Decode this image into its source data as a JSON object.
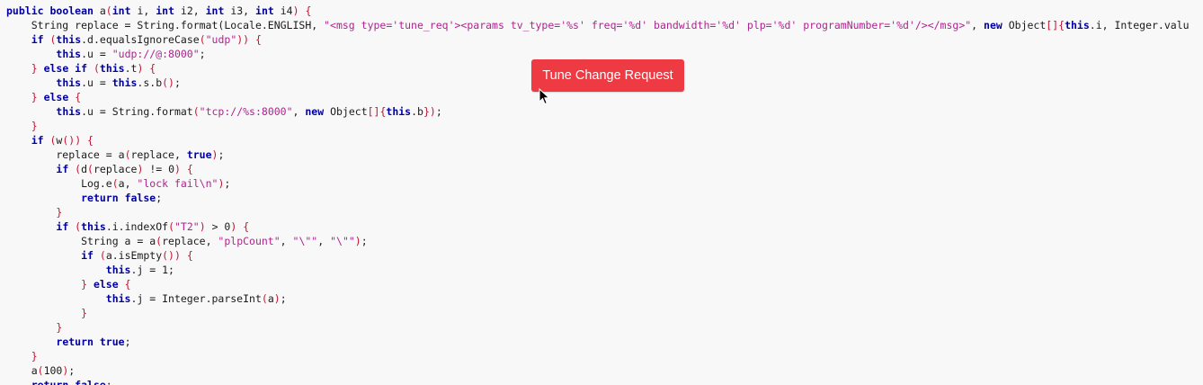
{
  "button": {
    "label": "Tune Change Request"
  },
  "cursor_icon": "arrow-pointer-icon",
  "colors": {
    "keyword": "#0000a0",
    "punctuation": "#c8102e",
    "string": "#b0238f",
    "text": "#1a1a1a",
    "button_bg": "#ee3a43",
    "background": "#f8f8f8"
  },
  "code_lines": [
    [
      [
        "kw",
        "public "
      ],
      [
        "kw",
        "boolean "
      ],
      [
        "plain",
        "a"
      ],
      [
        "punc",
        "("
      ],
      [
        "kw",
        "int "
      ],
      [
        "plain",
        "i, "
      ],
      [
        "kw",
        "int "
      ],
      [
        "plain",
        "i2, "
      ],
      [
        "kw",
        "int "
      ],
      [
        "plain",
        "i3, "
      ],
      [
        "kw",
        "int "
      ],
      [
        "plain",
        "i4"
      ],
      [
        "punc",
        ") {"
      ]
    ],
    [
      [
        "plain",
        "    String replace = String.format(Locale.ENGLISH, "
      ],
      [
        "str",
        "\"<msg type='tune_req'><params tv_type='%s' freq='%d' bandwidth='%d' plp='%d' programNumber='%d'/></msg>\""
      ],
      [
        "plain",
        ", "
      ],
      [
        "kw",
        "new "
      ],
      [
        "plain",
        "Object"
      ],
      [
        "punc",
        "[]{"
      ],
      [
        "kw",
        "this"
      ],
      [
        "plain",
        ".i, Integer.valu"
      ]
    ],
    [
      [
        "plain",
        "    "
      ],
      [
        "kw",
        "if "
      ],
      [
        "punc",
        "("
      ],
      [
        "kw",
        "this"
      ],
      [
        "plain",
        ".d.equalsIgnoreCase"
      ],
      [
        "punc",
        "("
      ],
      [
        "str",
        "\"udp\""
      ],
      [
        "punc",
        ")) {"
      ]
    ],
    [
      [
        "plain",
        "        "
      ],
      [
        "kw",
        "this"
      ],
      [
        "plain",
        ".u = "
      ],
      [
        "str",
        "\"udp://@:8000\""
      ],
      [
        "plain",
        ";"
      ]
    ],
    [
      [
        "plain",
        "    "
      ],
      [
        "punc",
        "} "
      ],
      [
        "kw",
        "else if "
      ],
      [
        "punc",
        "("
      ],
      [
        "kw",
        "this"
      ],
      [
        "plain",
        ".t"
      ],
      [
        "punc",
        ") {"
      ]
    ],
    [
      [
        "plain",
        "        "
      ],
      [
        "kw",
        "this"
      ],
      [
        "plain",
        ".u = "
      ],
      [
        "kw",
        "this"
      ],
      [
        "plain",
        ".s.b"
      ],
      [
        "punc",
        "()"
      ],
      [
        "plain",
        ";"
      ]
    ],
    [
      [
        "plain",
        "    "
      ],
      [
        "punc",
        "} "
      ],
      [
        "kw",
        "else "
      ],
      [
        "punc",
        "{"
      ]
    ],
    [
      [
        "plain",
        "        "
      ],
      [
        "kw",
        "this"
      ],
      [
        "plain",
        ".u = String.format"
      ],
      [
        "punc",
        "("
      ],
      [
        "str",
        "\"tcp://%s:8000\""
      ],
      [
        "plain",
        ", "
      ],
      [
        "kw",
        "new "
      ],
      [
        "plain",
        "Object"
      ],
      [
        "punc",
        "[]{"
      ],
      [
        "kw",
        "this"
      ],
      [
        "plain",
        ".b"
      ],
      [
        "punc",
        "})"
      ],
      [
        "plain",
        ";"
      ]
    ],
    [
      [
        "plain",
        "    "
      ],
      [
        "punc",
        "}"
      ]
    ],
    [
      [
        "plain",
        "    "
      ],
      [
        "kw",
        "if "
      ],
      [
        "punc",
        "("
      ],
      [
        "plain",
        "w"
      ],
      [
        "punc",
        "()) {"
      ]
    ],
    [
      [
        "plain",
        "        replace = a"
      ],
      [
        "punc",
        "("
      ],
      [
        "plain",
        "replace, "
      ],
      [
        "kw",
        "true"
      ],
      [
        "punc",
        ")"
      ],
      [
        "plain",
        ";"
      ]
    ],
    [
      [
        "plain",
        "        "
      ],
      [
        "kw",
        "if "
      ],
      [
        "punc",
        "("
      ],
      [
        "plain",
        "d"
      ],
      [
        "punc",
        "("
      ],
      [
        "plain",
        "replace"
      ],
      [
        "punc",
        ") "
      ],
      [
        "plain",
        "!= 0"
      ],
      [
        "punc",
        ") {"
      ]
    ],
    [
      [
        "plain",
        "            Log.e"
      ],
      [
        "punc",
        "("
      ],
      [
        "plain",
        "a, "
      ],
      [
        "str",
        "\"lock fail\\n\""
      ],
      [
        "punc",
        ")"
      ],
      [
        "plain",
        ";"
      ]
    ],
    [
      [
        "plain",
        "            "
      ],
      [
        "kw",
        "return "
      ],
      [
        "kw",
        "false"
      ],
      [
        "plain",
        ";"
      ]
    ],
    [
      [
        "plain",
        "        "
      ],
      [
        "punc",
        "}"
      ]
    ],
    [
      [
        "plain",
        "        "
      ],
      [
        "kw",
        "if "
      ],
      [
        "punc",
        "("
      ],
      [
        "kw",
        "this"
      ],
      [
        "plain",
        ".i.indexOf"
      ],
      [
        "punc",
        "("
      ],
      [
        "str",
        "\"T2\""
      ],
      [
        "punc",
        ") "
      ],
      [
        "plain",
        "> 0"
      ],
      [
        "punc",
        ") {"
      ]
    ],
    [
      [
        "plain",
        "            String a = a"
      ],
      [
        "punc",
        "("
      ],
      [
        "plain",
        "replace, "
      ],
      [
        "str",
        "\"plpCount\""
      ],
      [
        "plain",
        ", "
      ],
      [
        "str",
        "\"\\\"\""
      ],
      [
        "plain",
        ", "
      ],
      [
        "str",
        "\"\\\"\""
      ],
      [
        "punc",
        ")"
      ],
      [
        "plain",
        ";"
      ]
    ],
    [
      [
        "plain",
        "            "
      ],
      [
        "kw",
        "if "
      ],
      [
        "punc",
        "("
      ],
      [
        "plain",
        "a.isEmpty"
      ],
      [
        "punc",
        "()) {"
      ]
    ],
    [
      [
        "plain",
        "                "
      ],
      [
        "kw",
        "this"
      ],
      [
        "plain",
        ".j = 1;"
      ]
    ],
    [
      [
        "plain",
        "            "
      ],
      [
        "punc",
        "} "
      ],
      [
        "kw",
        "else "
      ],
      [
        "punc",
        "{"
      ]
    ],
    [
      [
        "plain",
        "                "
      ],
      [
        "kw",
        "this"
      ],
      [
        "plain",
        ".j = Integer.parseInt"
      ],
      [
        "punc",
        "("
      ],
      [
        "plain",
        "a"
      ],
      [
        "punc",
        ")"
      ],
      [
        "plain",
        ";"
      ]
    ],
    [
      [
        "plain",
        "            "
      ],
      [
        "punc",
        "}"
      ]
    ],
    [
      [
        "plain",
        "        "
      ],
      [
        "punc",
        "}"
      ]
    ],
    [
      [
        "plain",
        "        "
      ],
      [
        "kw",
        "return "
      ],
      [
        "kw",
        "true"
      ],
      [
        "plain",
        ";"
      ]
    ],
    [
      [
        "plain",
        "    "
      ],
      [
        "punc",
        "}"
      ]
    ],
    [
      [
        "plain",
        "    a"
      ],
      [
        "punc",
        "("
      ],
      [
        "plain",
        "100"
      ],
      [
        "punc",
        ")"
      ],
      [
        "plain",
        ";"
      ]
    ],
    [
      [
        "plain",
        "    "
      ],
      [
        "kw",
        "return "
      ],
      [
        "kw",
        "false"
      ],
      [
        "plain",
        ";"
      ]
    ]
  ]
}
